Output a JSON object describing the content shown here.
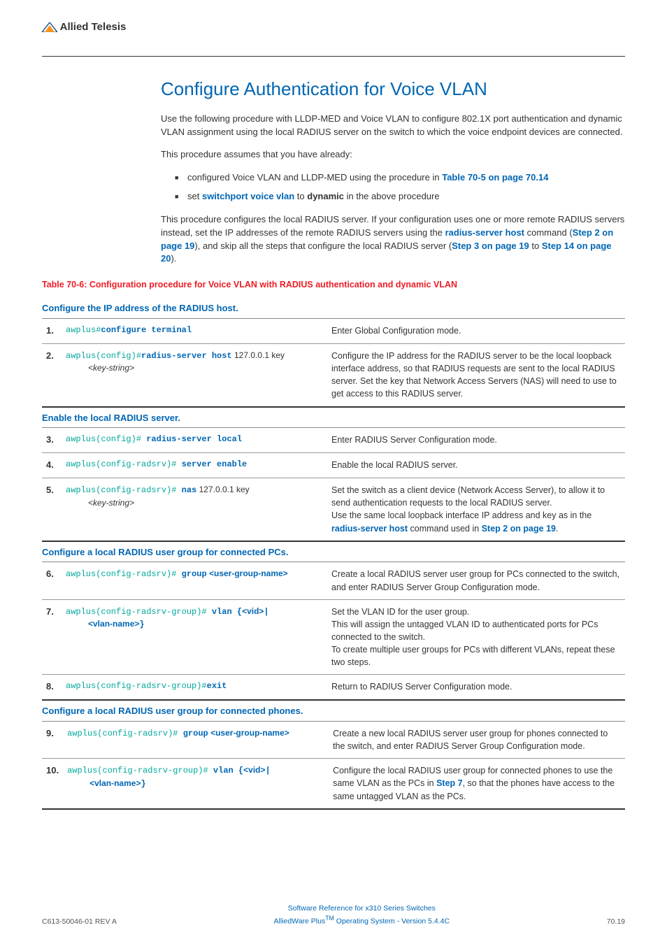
{
  "logo_text": "Allied Telesis",
  "title": "Configure Authentication for Voice VLAN",
  "intro_para": "Use the following procedure with LLDP-MED and Voice VLAN to configure 802.1X port authentication and dynamic VLAN assignment using the local RADIUS server on the switch to which the voice endpoint devices are connected.",
  "assume_para": "This procedure assumes that you have already:",
  "bullets": {
    "b1_pre": "configured Voice VLAN and LLDP-MED using the procedure in ",
    "b1_link": "Table 70-5 on page 70.14",
    "b2_pre": "set ",
    "b2_link": "switchport voice vlan",
    "b2_mid": " to ",
    "b2_bold": "dynamic",
    "b2_post": " in the above procedure"
  },
  "closing_para_1": "This procedure configures the local RADIUS server. If your configuration uses one or more remote RADIUS servers instead, set the IP addresses of the remote RADIUS servers using the ",
  "closing_link_1": "radius-server host",
  "closing_para_2": " command (",
  "closing_link_2": "Step 2 on page 19",
  "closing_para_3": "), and skip all the steps that configure the local RADIUS server (",
  "closing_link_3": "Step 3 on page 19",
  "closing_para_4": " to ",
  "closing_link_4": "Step 14 on page 20",
  "closing_para_5": ").",
  "table_caption": "Table 70-6: Configuration procedure for Voice VLAN with RADIUS authentication and dynamic VLAN",
  "sections": {
    "s1": "Configure the IP address of the RADIUS host.",
    "s2": "Enable the local RADIUS server.",
    "s3": "Configure a local RADIUS user group for connected PCs.",
    "s4": "Configure a local RADIUS user group for connected phones."
  },
  "steps": {
    "1": {
      "prompt": "awplus#",
      "cmd": "configure terminal",
      "desc": "Enter Global Configuration mode."
    },
    "2": {
      "prompt": "awplus(config)#",
      "cmd": "radius-server host",
      "args": " 127.0.0.1 key",
      "arg2_label": "<key-string>",
      "desc": "Configure the IP address for the RADIUS server to be the local loopback interface address, so that RADIUS requests are sent to the local RADIUS server. Set the key that Network Access Servers (NAS) will need to use to get access to this RADIUS server."
    },
    "3": {
      "prompt": "awplus(config)#",
      "cmd": " radius-server local",
      "desc": "Enter RADIUS Server Configuration mode."
    },
    "4": {
      "prompt": "awplus(config-radsrv)#",
      "cmd": " server enable",
      "desc": "Enable the local RADIUS server."
    },
    "5": {
      "prompt": "awplus(config-radsrv)#",
      "cmd": " nas",
      "args": " 127.0.0.1 key",
      "arg2_label": "<key-string>",
      "desc1": "Set the switch as a client device (Network Access Server), to allow it to send authentication requests to the local RADIUS server.",
      "desc2a": "Use the same local loopback interface IP address and key as in the ",
      "desc2_link": "radius-server host",
      "desc2b": " command used in ",
      "desc2_link2": "Step 2 on page 19",
      "desc2c": "."
    },
    "6": {
      "prompt": "awplus(config-radsrv)#",
      "cmd_pre": " group",
      "cmd_var": " <user-group-name>",
      "desc": "Create a local RADIUS server user group for PCs connected to the switch, and enter RADIUS Server Group Configuration mode."
    },
    "7": {
      "prompt": "awplus(config-radsrv-group)#",
      "cmd_pre": " vlan {",
      "cmd_var1": "<vid>",
      "cmd_mid": "|",
      "cmd_var2": "<vlan-name>",
      "cmd_post": "}",
      "desc1": "Set the VLAN ID for the user group.",
      "desc2": "This will assign the untagged VLAN ID to authenticated ports for PCs connected to the switch.",
      "desc3": "To create multiple user groups for PCs with different VLANs, repeat these two steps."
    },
    "8": {
      "prompt": "awplus(config-radsrv-group)#",
      "cmd": "exit",
      "desc": "Return to RADIUS Server Configuration mode."
    },
    "9": {
      "prompt": "awplus(config-radsrv)#",
      "cmd_pre": " group",
      "cmd_var": " <user-group-name>",
      "desc": "Create a new local RADIUS server user group for phones connected to the switch, and enter RADIUS Server Group Configuration mode."
    },
    "10": {
      "prompt": "awplus(config-radsrv-group)#",
      "cmd_pre": " vlan {",
      "cmd_var1": "<vid>",
      "cmd_mid": "|",
      "cmd_var2": "<vlan-name>",
      "cmd_post": "}",
      "desc1": "Configure the local RADIUS user group for connected phones to use the same VLAN as the PCs in ",
      "desc_link": "Step 7",
      "desc2": ", so that the phones have access to the same untagged VLAN as the PCs."
    }
  },
  "footer": {
    "left": "C613-50046-01 REV A",
    "center1": "Software Reference for x310 Series Switches",
    "center2a": "AlliedWare Plus",
    "center2_tm": "TM",
    "center2b": " Operating System - Version 5.4.4C",
    "right": "70.19"
  }
}
